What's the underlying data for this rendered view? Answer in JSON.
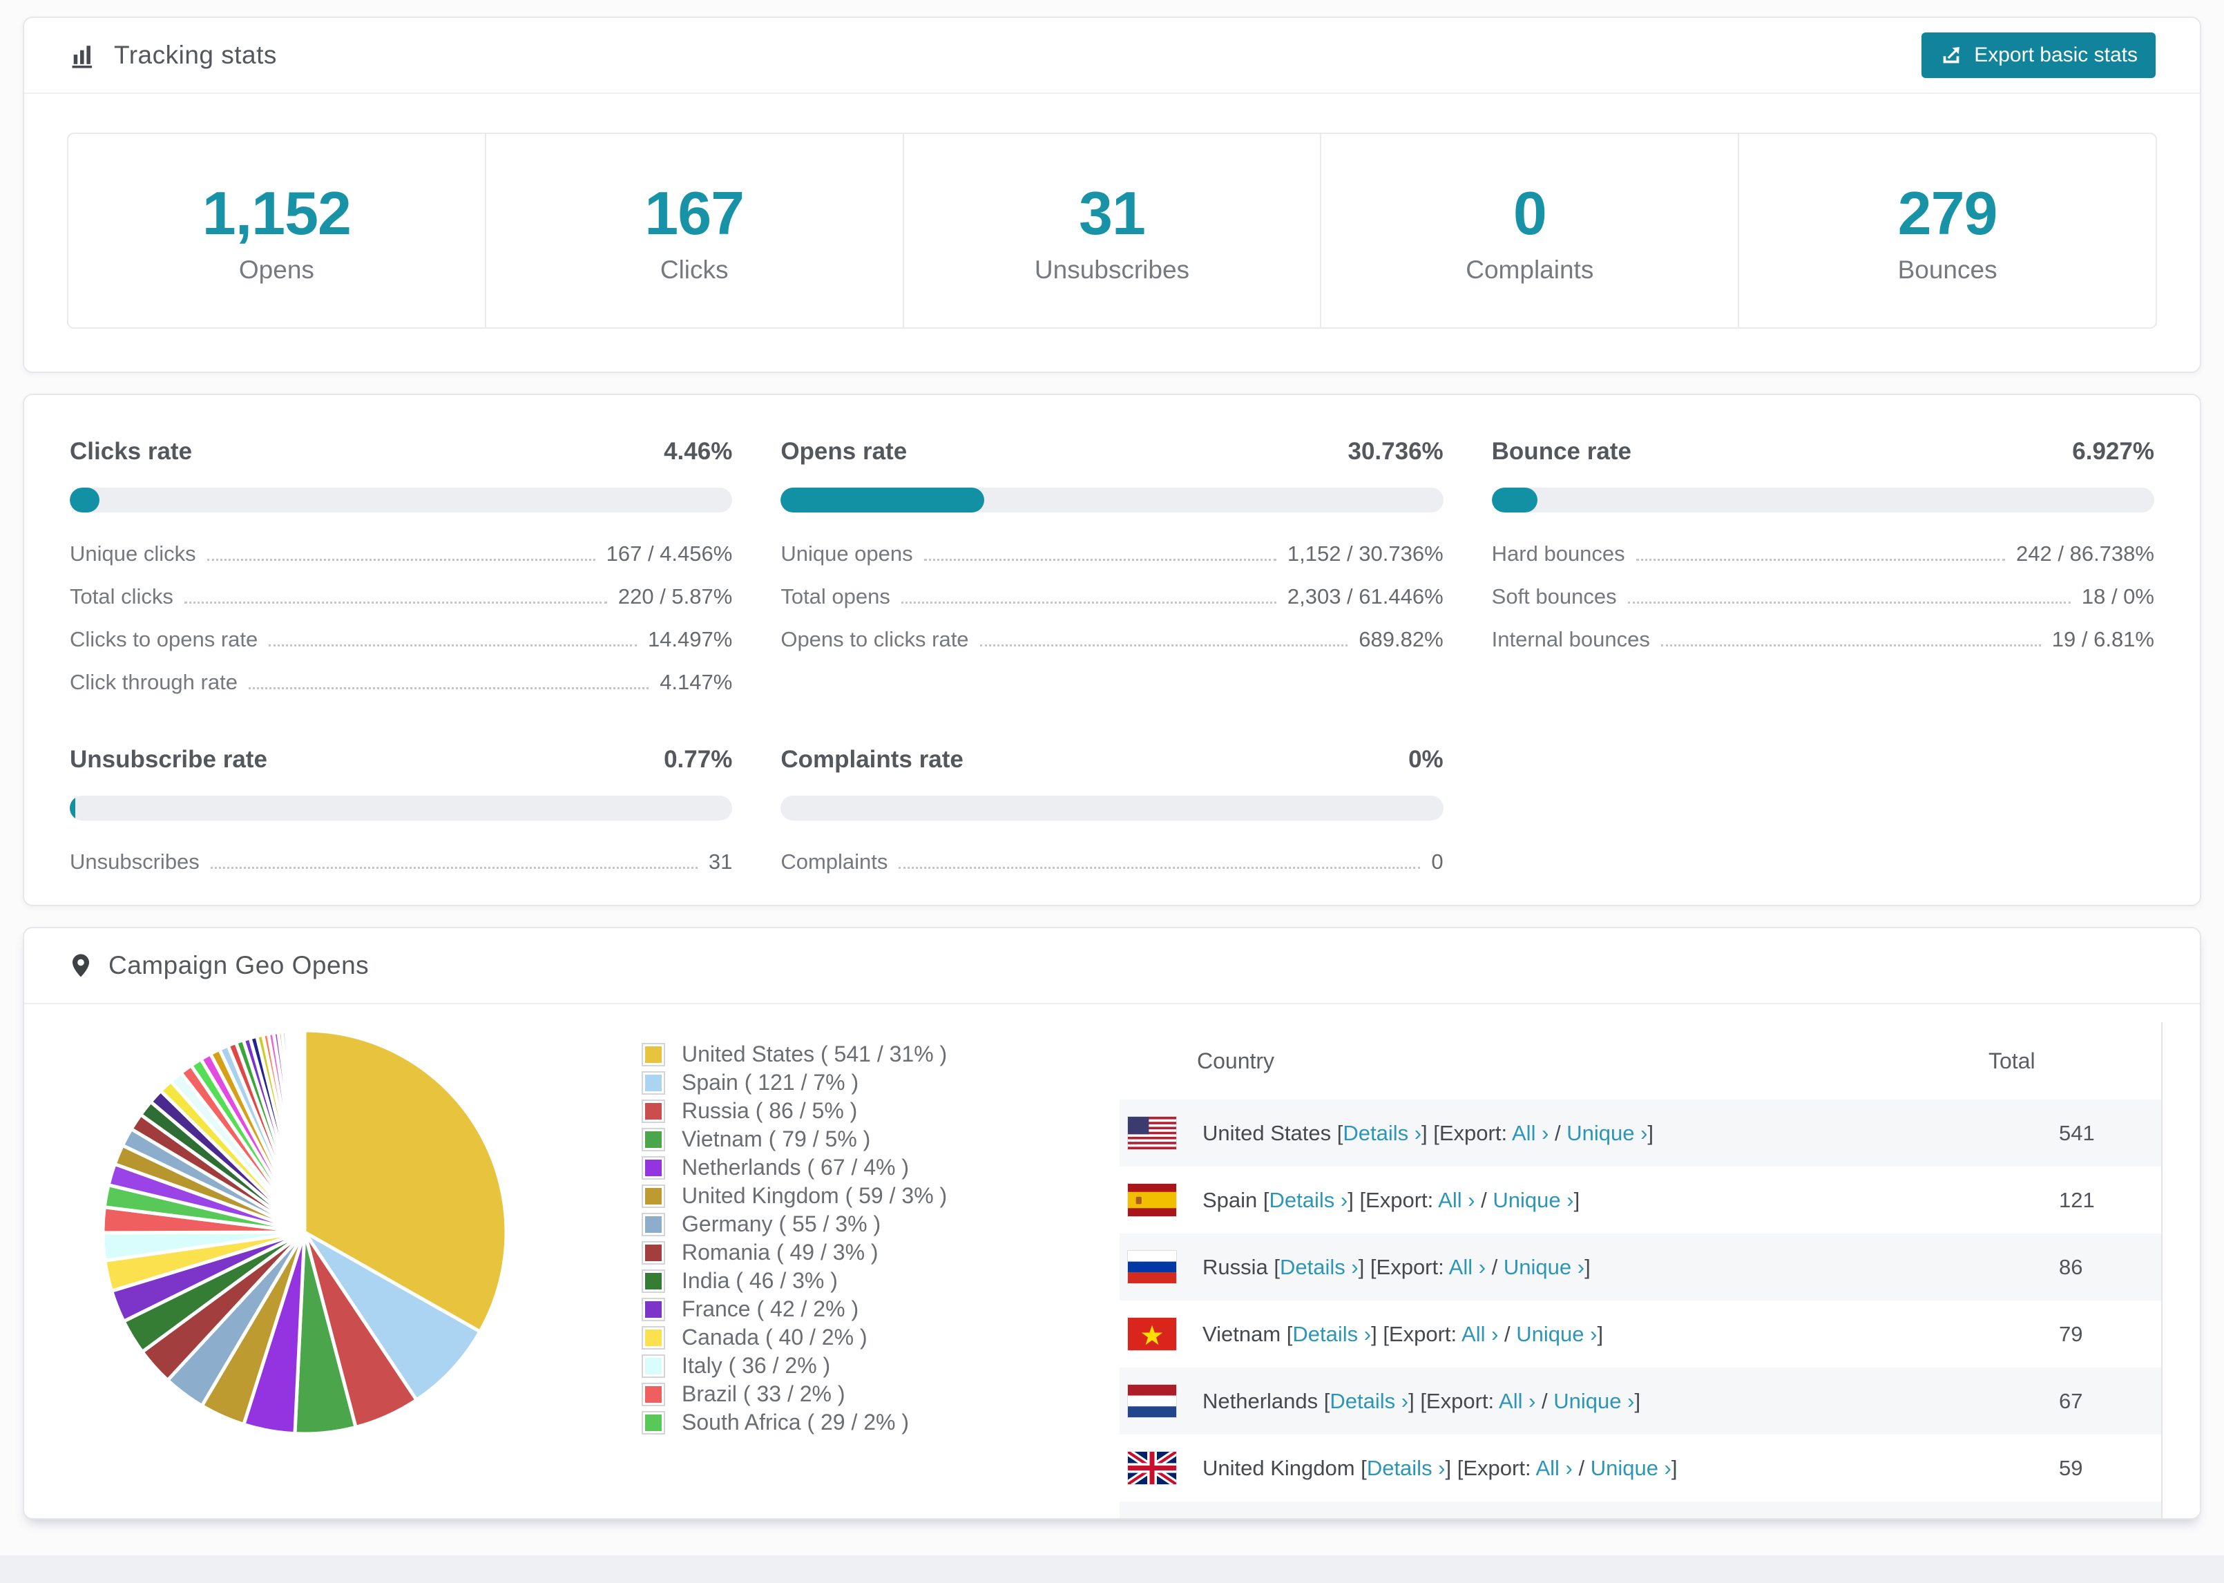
{
  "colors": {
    "accent_teal": "#1792a7",
    "button_teal": "#11849b",
    "link_teal": "#2d96b8",
    "bar_track": "#edeef1",
    "bar_fill": "#1290a4"
  },
  "tracking": {
    "title": "Tracking stats",
    "export_button": "Export basic stats",
    "summary": [
      {
        "value": "1,152",
        "label": "Opens"
      },
      {
        "value": "167",
        "label": "Clicks"
      },
      {
        "value": "31",
        "label": "Unsubscribes"
      },
      {
        "value": "0",
        "label": "Complaints"
      },
      {
        "value": "279",
        "label": "Bounces"
      }
    ]
  },
  "rates": [
    {
      "title": "Clicks rate",
      "value": "4.46%",
      "percent": 4.46,
      "rows": [
        {
          "label": "Unique clicks",
          "value": "167 / 4.456%"
        },
        {
          "label": "Total clicks",
          "value": "220 / 5.87%"
        },
        {
          "label": "Clicks to opens rate",
          "value": "14.497%"
        },
        {
          "label": "Click through rate",
          "value": "4.147%"
        }
      ]
    },
    {
      "title": "Opens rate",
      "value": "30.736%",
      "percent": 30.736,
      "rows": [
        {
          "label": "Unique opens",
          "value": "1,152 / 30.736%"
        },
        {
          "label": "Total opens",
          "value": "2,303 / 61.446%"
        },
        {
          "label": "Opens to clicks rate",
          "value": "689.82%"
        }
      ]
    },
    {
      "title": "Bounce rate",
      "value": "6.927%",
      "percent": 6.927,
      "rows": [
        {
          "label": "Hard bounces",
          "value": "242 / 86.738%"
        },
        {
          "label": "Soft bounces",
          "value": "18 / 0%"
        },
        {
          "label": "Internal bounces",
          "value": "19 / 6.81%"
        }
      ]
    },
    {
      "title": "Unsubscribe rate",
      "value": "0.77%",
      "percent": 0.77,
      "rows": [
        {
          "label": "Unsubscribes",
          "value": "31"
        }
      ]
    },
    {
      "title": "Complaints rate",
      "value": "0%",
      "percent": 0,
      "rows": [
        {
          "label": "Complaints",
          "value": "0"
        }
      ]
    }
  ],
  "geo": {
    "title": "Campaign Geo Opens",
    "table": {
      "columns": [
        "Country",
        "Total"
      ],
      "link_details": "Details",
      "link_export_prefix": "Export:",
      "link_all": "All",
      "link_unique": "Unique",
      "chevron": "›",
      "rows": [
        {
          "flag": "us",
          "country": "United States",
          "total": "541"
        },
        {
          "flag": "es",
          "country": "Spain",
          "total": "121"
        },
        {
          "flag": "ru",
          "country": "Russia",
          "total": "86"
        },
        {
          "flag": "vn",
          "country": "Vietnam",
          "total": "79"
        },
        {
          "flag": "nl",
          "country": "Netherlands",
          "total": "67"
        },
        {
          "flag": "gb",
          "country": "United Kingdom",
          "total": "59"
        },
        {
          "flag": "de",
          "country": "",
          "total": "",
          "partial": true
        }
      ]
    }
  },
  "chart_data": {
    "type": "pie",
    "title": "Campaign Geo Opens",
    "legend_position": "right",
    "start_angle_deg": -90,
    "slices": [
      {
        "label": "United States",
        "value": 541,
        "percent": "31%",
        "color": "#e8c33d"
      },
      {
        "label": "Spain",
        "value": 121,
        "percent": "7%",
        "color": "#abd3f2"
      },
      {
        "label": "Russia",
        "value": 86,
        "percent": "5%",
        "color": "#cc4d4d"
      },
      {
        "label": "Vietnam",
        "value": 79,
        "percent": "5%",
        "color": "#4ba64b"
      },
      {
        "label": "Netherlands",
        "value": 67,
        "percent": "4%",
        "color": "#9433e0"
      },
      {
        "label": "United Kingdom",
        "value": 59,
        "percent": "3%",
        "color": "#bd9b31"
      },
      {
        "label": "Germany",
        "value": 55,
        "percent": "3%",
        "color": "#8cadcc"
      },
      {
        "label": "Romania",
        "value": 49,
        "percent": "3%",
        "color": "#a33e3e"
      },
      {
        "label": "India",
        "value": 46,
        "percent": "3%",
        "color": "#357c35"
      },
      {
        "label": "France",
        "value": 42,
        "percent": "2%",
        "color": "#7c35c8"
      },
      {
        "label": "Canada",
        "value": 40,
        "percent": "2%",
        "color": "#fce14e"
      },
      {
        "label": "Italy",
        "value": 36,
        "percent": "2%",
        "color": "#d9fdfd"
      },
      {
        "label": "Brazil",
        "value": 33,
        "percent": "2%",
        "color": "#f05f5f"
      },
      {
        "label": "South Africa",
        "value": 29,
        "percent": "2%",
        "color": "#58c958"
      }
    ],
    "unlabeled_small_slices": [
      28,
      26,
      24,
      22,
      21,
      19,
      18,
      17,
      16,
      15,
      14,
      13,
      12,
      11,
      10,
      9,
      9,
      8,
      7,
      7,
      6,
      5,
      5,
      4,
      4,
      3,
      3,
      2,
      2,
      2,
      1,
      1,
      1,
      1
    ],
    "small_slice_palette": [
      "#9a44e8",
      "#b8962e",
      "#8cadcc",
      "#a03c3c",
      "#2e6e34",
      "#4b2a8f",
      "#f5e642",
      "#e6fbfb",
      "#f56262",
      "#55dd55",
      "#e24ae2",
      "#d4a017",
      "#a8d1f0",
      "#e04848",
      "#3aa63a",
      "#7733cc",
      "#23238e",
      "#cccc22",
      "#ff7f50",
      "#dd66dd"
    ]
  }
}
